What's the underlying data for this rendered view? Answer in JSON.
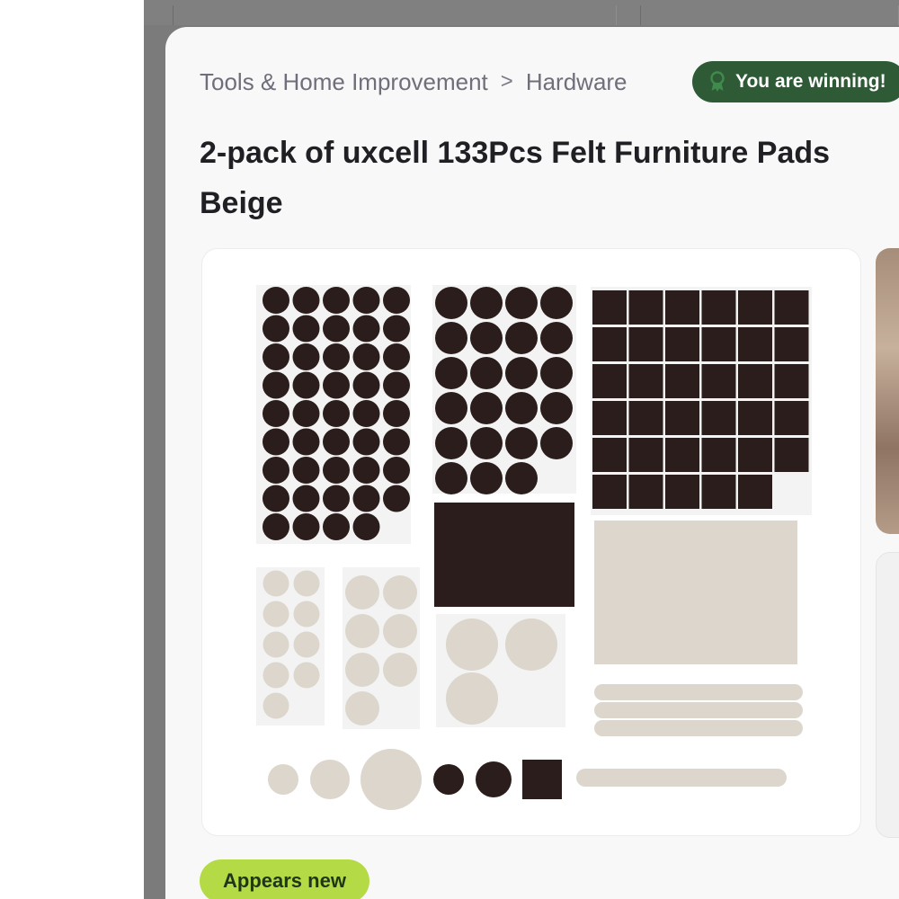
{
  "breadcrumb": {
    "category": "Tools & Home Improvement",
    "separator": ">",
    "subcategory": "Hardware"
  },
  "status_badge": {
    "label": "You are winning!",
    "icon": "ribbon-icon",
    "color": "#2e5a36"
  },
  "product": {
    "title": "2-pack of uxcell 133Pcs Felt Furniture Pads Beige",
    "condition_label": "Appears new",
    "condition_color": "#b4db45"
  },
  "colors": {
    "felt_brown": "#2a1d1b",
    "felt_beige": "#dcd6cc"
  }
}
